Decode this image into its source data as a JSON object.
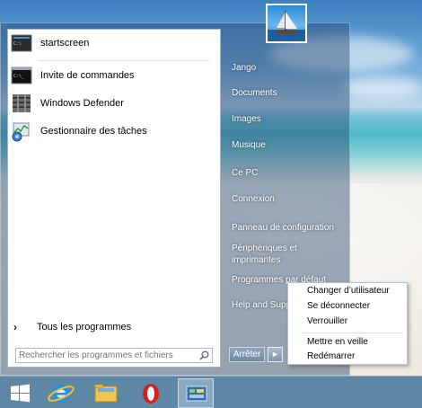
{
  "start_menu": {
    "pinned": [
      {
        "label": "startscreen",
        "icon": "startscreen-icon"
      },
      {
        "label": "Invite de commandes",
        "icon": "cmd-icon"
      },
      {
        "label": "Windows Defender",
        "icon": "defender-icon"
      },
      {
        "label": "Gestionnaire des tâches",
        "icon": "task-manager-icon"
      }
    ],
    "all_programs": "Tous les programmes",
    "search_placeholder": "Rechercher les programmes et fichiers",
    "right_links": [
      "Jango",
      "Documents",
      "Images",
      "Musique",
      "Ce PC",
      "Connexion",
      "Panneau de configuration",
      "Périphériques et\nimprimantes",
      "Programmes par défaut",
      "Help and Supp"
    ],
    "shutdown_label": "Arrêter",
    "shutdown_arrow": "►"
  },
  "context_menu": {
    "items": [
      "Changer d’utilisateur",
      "Se déconnecter",
      "Verrouiller",
      "Mettre en veille",
      "Redémarrer"
    ]
  },
  "taskbar": {
    "items": [
      "start-button",
      "internet-explorer",
      "file-explorer",
      "opera",
      "control-panel"
    ]
  }
}
